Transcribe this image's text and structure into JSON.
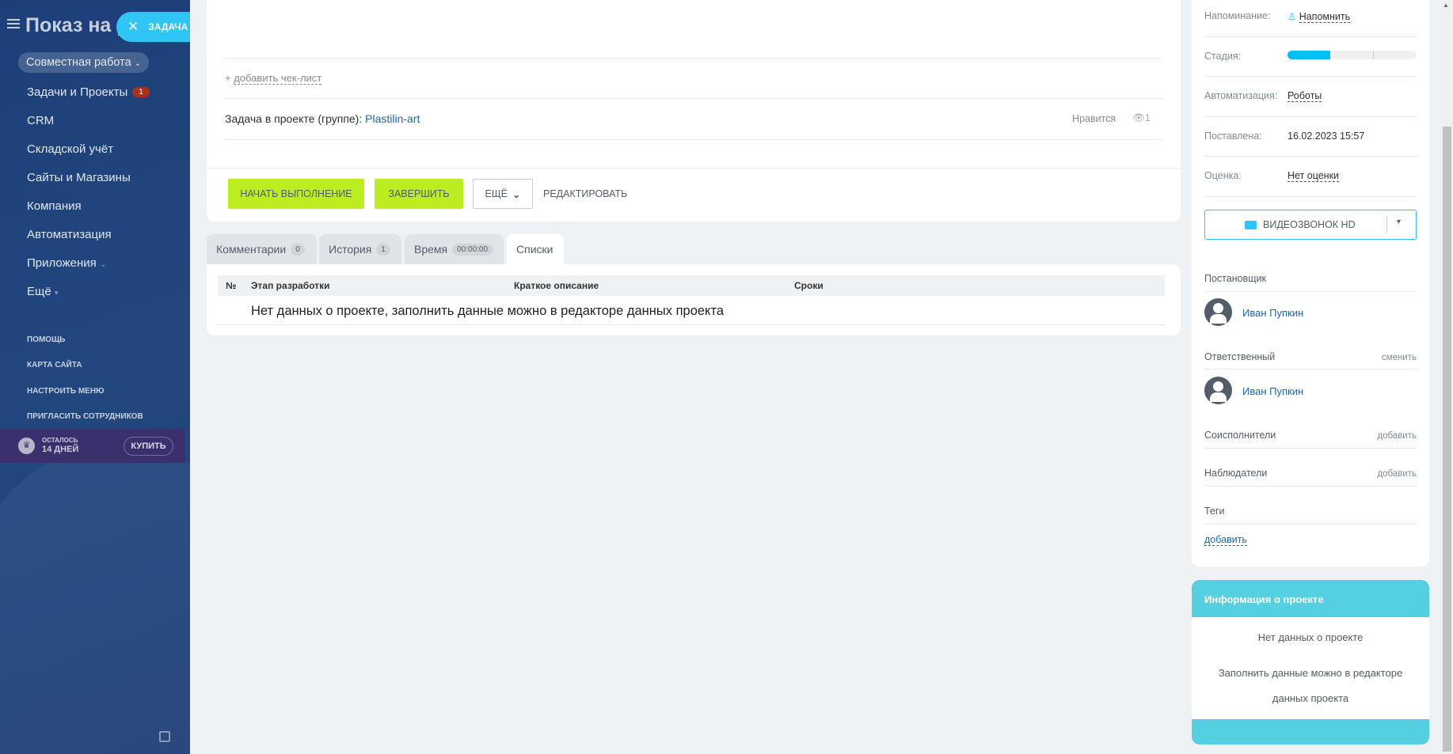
{
  "sidebar": {
    "title": "Показ на р",
    "task_pill": "ЗАДАЧА",
    "group_pill": "Совместная работа",
    "items": [
      {
        "label": "Задачи и Проекты",
        "badge": "1"
      },
      {
        "label": "CRM"
      },
      {
        "label": "Складской учёт"
      },
      {
        "label": "Сайты и Магазины"
      },
      {
        "label": "Компания"
      },
      {
        "label": "Автоматизация"
      },
      {
        "label": "Приложения"
      },
      {
        "label": "Ещё"
      }
    ],
    "links": [
      "ПОМОЩЬ",
      "КАРТА САЙТА",
      "НАСТРОИТЬ МЕНЮ",
      "ПРИГЛАСИТЬ СОТРУДНИКОВ"
    ],
    "trial": {
      "line1": "ОСТАЛОСЬ",
      "line2": "14 ДНЕЙ",
      "buy": "КУПИТЬ"
    }
  },
  "task": {
    "add_checklist": "добавить чек-лист",
    "project_label": "Задача в проекте (группе):",
    "project_name": "Plastilin-art",
    "like": "Нравится",
    "views": "1",
    "buttons": {
      "start": "НАЧАТЬ ВЫПОЛНЕНИЕ",
      "finish": "ЗАВЕРШИТЬ",
      "more": "ЕЩЁ",
      "edit": "РЕДАКТИРОВАТЬ"
    }
  },
  "tabs": [
    {
      "label": "Комментарии",
      "count": "0"
    },
    {
      "label": "История",
      "count": "1"
    },
    {
      "label": "Время",
      "count": "00:00:00"
    },
    {
      "label": "Списки"
    }
  ],
  "list_table": {
    "columns": [
      "№",
      "Этап разработки",
      "Краткое описание",
      "Сроки"
    ],
    "empty": "Нет данных о проекте, заполнить данные можно в редакторе данных проекта"
  },
  "right_panel": {
    "reminder_label": "Напоминание:",
    "reminder_value": "Напомнить",
    "stage_label": "Стадия:",
    "stage_progress": 0.33,
    "automation_label": "Автоматизация:",
    "automation_value": "Роботы",
    "created_label": "Поставлена:",
    "created_value": "16.02.2023 15:57",
    "rating_label": "Оценка:",
    "rating_value": "Нет оценки",
    "video_call": "ВИДЕОЗВОНОК HD",
    "creator_label": "Постановщик",
    "creator_name": "Иван Пупкин",
    "responsible_label": "Ответственный",
    "responsible_change": "сменить",
    "responsible_name": "Иван Пупкин",
    "coexec_label": "Соисполнители",
    "coexec_add": "добавить",
    "observers_label": "Наблюдатели",
    "observers_add": "добавить",
    "tags_label": "Теги",
    "tags_add": "добавить"
  },
  "project_info": {
    "title": "Информация о проекте",
    "line1": "Нет данных о проекте",
    "line2": "Заполнить данные можно в редакторе данных проекта"
  }
}
